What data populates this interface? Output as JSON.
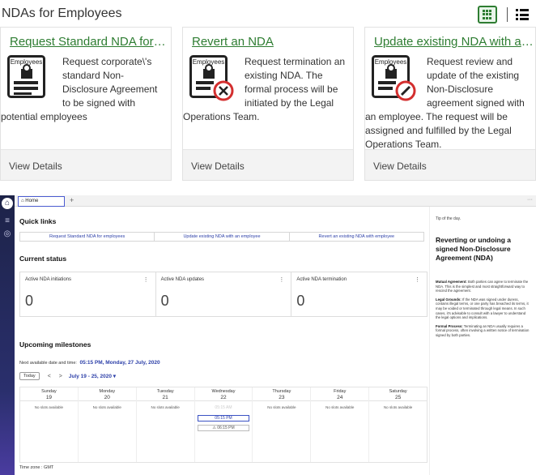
{
  "top": {
    "title": "NDAs for Employees",
    "cards": [
      {
        "title": "Request Standard NDA for em…",
        "icon_label": "Employees",
        "icon": "employees-list-icon",
        "description": "Request corporate\\'s standard Non-Disclosure Agreement to be signed with potential employees",
        "footer": "View Details"
      },
      {
        "title": "Revert an NDA",
        "icon_label": "Employees",
        "icon": "employees-cancel-icon",
        "description": "Request termination an existing NDA. The formal process will be initiated by the Legal Operations Team.",
        "footer": "View Details"
      },
      {
        "title": "Update existing NDA with an …",
        "icon_label": "Employees",
        "icon": "employees-edit-icon",
        "description": "Request review and update of the existing Non-Disclosure agreement signed with an employee. The request will be assigned and fulfilled by the Legal Operations Team.",
        "footer": "View Details"
      }
    ]
  },
  "app": {
    "tab": {
      "label": "⌂ Home",
      "add": "+",
      "more": "···"
    },
    "quick_links": {
      "title": "Quick links",
      "items": [
        "Request Standard NDA for employees",
        "Update existing NDA with an employee",
        "Revert an existing NDA with employee"
      ]
    },
    "status": {
      "title": "Current status",
      "cards": [
        {
          "label": "Active NDA initiations",
          "value": "0"
        },
        {
          "label": "Active NDA updates",
          "value": "0"
        },
        {
          "label": "Active NDA termination",
          "value": "0"
        }
      ]
    },
    "milestones": {
      "title": "Upcoming milestones",
      "next_label": "Next available date and time:",
      "next_value": "05:15 PM, Monday, 27 July, 2020",
      "today": "Today",
      "prev": "<",
      "next": ">",
      "range": "July 19 - 25, 2020 ▾",
      "days": [
        {
          "name": "Sunday",
          "date": "19",
          "empty": "No slots available"
        },
        {
          "name": "Monday",
          "date": "20",
          "empty": "No slots available"
        },
        {
          "name": "Tuesday",
          "date": "21",
          "empty": "No slots available"
        },
        {
          "name": "Wednesday",
          "date": "22",
          "slots": [
            "05:15 AM",
            "05:15 PM",
            "⚠ 06:15 PM"
          ]
        },
        {
          "name": "Thursday",
          "date": "23",
          "empty": "No slots available"
        },
        {
          "name": "Friday",
          "date": "24",
          "empty": "No slots available"
        },
        {
          "name": "Saturday",
          "date": "25",
          "empty": "No slots available"
        }
      ],
      "timezone": "Time zone : GMT"
    },
    "tip": {
      "label": "Tip of the day.",
      "title": "Reverting or undoing a signed Non-Disclosure Agreement (NDA)",
      "paragraphs": [
        {
          "head": "Mutual Agreement:",
          "text": " Both parties can agree to terminate the NDA. This is the simplest and most straightforward way to rescind the agreement."
        },
        {
          "head": "Legal Grounds:",
          "text": " If the NDA was signed under duress, contains illegal terms, or one party has breached its terms, it may be voided or terminated through legal means. In such cases, it's advisable to consult with a lawyer to understand the legal options and implications."
        },
        {
          "head": "Formal Process:",
          "text": " Terminating an NDA usually requires a formal process, often involving a written notice of termination signed by both parties."
        }
      ]
    }
  },
  "colors": {
    "accent_green": "#2e7d32",
    "link_blue": "#2c3fa8",
    "rail": "#1d2348"
  }
}
